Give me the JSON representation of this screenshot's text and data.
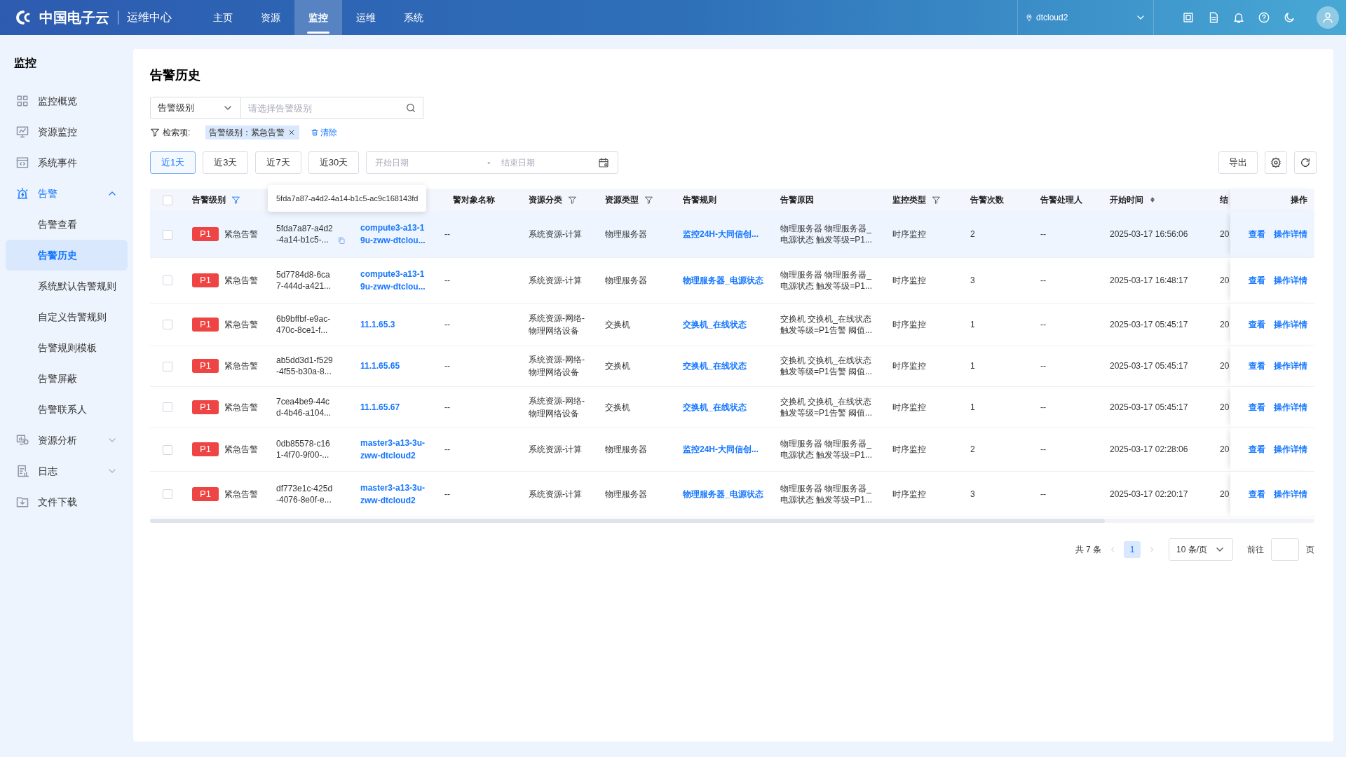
{
  "header": {
    "logo": "中国电子云",
    "product": "运维中心",
    "nav": [
      {
        "label": "主页",
        "selected": false
      },
      {
        "label": "资源",
        "selected": false
      },
      {
        "label": "监控",
        "selected": true
      },
      {
        "label": "运维",
        "selected": false
      },
      {
        "label": "系统",
        "selected": false
      }
    ],
    "cloud": "dtcloud2"
  },
  "sidebar": {
    "title": "监控",
    "items": [
      {
        "label": "监控概览",
        "selected": false
      },
      {
        "label": "资源监控",
        "selected": false
      },
      {
        "label": "系统事件",
        "selected": false
      },
      {
        "label": "告警",
        "selected": false,
        "expanded": true,
        "children": [
          {
            "label": "告警查看",
            "selected": false
          },
          {
            "label": "告警历史",
            "selected": true
          },
          {
            "label": "系统默认告警规则",
            "selected": false
          },
          {
            "label": "自定义告警规则",
            "selected": false
          },
          {
            "label": "告警规则模板",
            "selected": false
          },
          {
            "label": "告警屏蔽",
            "selected": false
          },
          {
            "label": "告警联系人",
            "selected": false
          }
        ]
      },
      {
        "label": "资源分析",
        "selected": false,
        "expanded": false
      },
      {
        "label": "日志",
        "selected": false,
        "expanded": false
      },
      {
        "label": "文件下载",
        "selected": false
      }
    ]
  },
  "page": {
    "title": "告警历史",
    "search": {
      "field": "告警级别",
      "placeholder": "请选择告警级别"
    },
    "filter": {
      "label": "检索项:",
      "tags": [
        "告警级别：紧急告警"
      ],
      "clear": "清除"
    },
    "ranges": [
      {
        "label": "近1天",
        "selected": true
      },
      {
        "label": "近3天",
        "selected": false
      },
      {
        "label": "近7天",
        "selected": false
      },
      {
        "label": "近30天",
        "selected": false
      }
    ],
    "date_range": {
      "start_placeholder": "开始日期",
      "separator": "-",
      "end_placeholder": "结束日期"
    },
    "export": "导出",
    "table": {
      "select_all": {
        "checked": false
      },
      "columns": [
        {
          "label": "告警级别",
          "filter": true
        },
        {
          "label": "警对象名称"
        },
        {
          "label": "资源分类",
          "filter": true
        },
        {
          "label": "资源类型",
          "filter": true
        },
        {
          "label": "告警规则"
        },
        {
          "label": "告警原因"
        },
        {
          "label": "监控类型",
          "filter": true
        },
        {
          "label": "告警次数"
        },
        {
          "label": "告警处理人"
        },
        {
          "label": "开始时间",
          "sortable": true
        },
        {
          "label": "结"
        },
        {
          "label": "操作"
        }
      ],
      "tooltip": "5fda7a87-a4d2-4a14-b1c5-ac9c168143fd",
      "rows": [
        {
          "highlighted": true,
          "checked": false,
          "badge": "P1",
          "level": "紧急告警",
          "id": [
            "5fda7a87-a4d2",
            "-4a14-b1c5-..."
          ],
          "copy": true,
          "object": [
            "compute3-a13-1",
            "9u-zww-dtclou..."
          ],
          "name": "--",
          "category": [
            "系统资源-计算"
          ],
          "type": "物理服务器",
          "rule": "监控24H-大同信创...",
          "reason": [
            "物理服务器 物理服务器_",
            "电源状态 触发等级=P1..."
          ],
          "monitor": "时序监控",
          "count": "2",
          "handler": "--",
          "start": "2025-03-17 16:56:06",
          "end": "20",
          "actions": [
            "查看",
            "操作详情"
          ]
        },
        {
          "highlighted": false,
          "checked": false,
          "badge": "P1",
          "level": "紧急告警",
          "id": [
            "5d7784d8-6ca",
            "7-444d-a421..."
          ],
          "object": [
            "compute3-a13-1",
            "9u-zww-dtclou..."
          ],
          "name": "--",
          "category": [
            "系统资源-计算"
          ],
          "type": "物理服务器",
          "rule": "物理服务器_电源状态",
          "reason": [
            "物理服务器 物理服务器_",
            "电源状态 触发等级=P1..."
          ],
          "monitor": "时序监控",
          "count": "3",
          "handler": "--",
          "start": "2025-03-17 16:48:17",
          "end": "20",
          "actions": [
            "查看",
            "操作详情"
          ]
        },
        {
          "highlighted": false,
          "checked": false,
          "badge": "P1",
          "level": "紧急告警",
          "id": [
            "6b9bffbf-e9ac-",
            "470c-8ce1-f..."
          ],
          "object": [
            "11.1.65.3"
          ],
          "name": "--",
          "category": [
            "系统资源-网络-",
            "物理网络设备"
          ],
          "type": "交换机",
          "rule": "交换机_在线状态",
          "reason": [
            "交换机 交换机_在线状态",
            "触发等级=P1告警 阈值..."
          ],
          "monitor": "时序监控",
          "count": "1",
          "handler": "--",
          "start": "2025-03-17 05:45:17",
          "end": "20",
          "actions": [
            "查看",
            "操作详情"
          ]
        },
        {
          "highlighted": false,
          "checked": false,
          "badge": "P1",
          "level": "紧急告警",
          "id": [
            "ab5dd3d1-f529",
            "-4f55-b30a-8..."
          ],
          "object": [
            "11.1.65.65"
          ],
          "name": "--",
          "category": [
            "系统资源-网络-",
            "物理网络设备"
          ],
          "type": "交换机",
          "rule": "交换机_在线状态",
          "reason": [
            "交换机 交换机_在线状态",
            "触发等级=P1告警 阈值..."
          ],
          "monitor": "时序监控",
          "count": "1",
          "handler": "--",
          "start": "2025-03-17 05:45:17",
          "end": "20",
          "actions": [
            "查看",
            "操作详情"
          ]
        },
        {
          "highlighted": false,
          "checked": false,
          "badge": "P1",
          "level": "紧急告警",
          "id": [
            "7cea4be9-44c",
            "d-4b46-a104..."
          ],
          "object": [
            "11.1.65.67"
          ],
          "name": "--",
          "category": [
            "系统资源-网络-",
            "物理网络设备"
          ],
          "type": "交换机",
          "rule": "交换机_在线状态",
          "reason": [
            "交换机 交换机_在线状态",
            "触发等级=P1告警 阈值..."
          ],
          "monitor": "时序监控",
          "count": "1",
          "handler": "--",
          "start": "2025-03-17 05:45:17",
          "end": "20",
          "actions": [
            "查看",
            "操作详情"
          ]
        },
        {
          "highlighted": false,
          "checked": false,
          "badge": "P1",
          "level": "紧急告警",
          "id": [
            "0db85578-c16",
            "1-4f70-9f00-..."
          ],
          "object": [
            "master3-a13-3u-",
            "zww-dtcloud2"
          ],
          "name": "--",
          "category": [
            "系统资源-计算"
          ],
          "type": "物理服务器",
          "rule": "监控24H-大同信创...",
          "reason": [
            "物理服务器 物理服务器_",
            "电源状态 触发等级=P1..."
          ],
          "monitor": "时序监控",
          "count": "2",
          "handler": "--",
          "start": "2025-03-17 02:28:06",
          "end": "20",
          "actions": [
            "查看",
            "操作详情"
          ]
        },
        {
          "highlighted": false,
          "checked": false,
          "badge": "P1",
          "level": "紧急告警",
          "id": [
            "df773e1c-425d",
            "-4076-8e0f-e..."
          ],
          "object": [
            "master3-a13-3u-",
            "zww-dtcloud2"
          ],
          "name": "--",
          "category": [
            "系统资源-计算"
          ],
          "type": "物理服务器",
          "rule": "物理服务器_电源状态",
          "reason": [
            "物理服务器 物理服务器_",
            "电源状态 触发等级=P1..."
          ],
          "monitor": "时序监控",
          "count": "3",
          "handler": "--",
          "start": "2025-03-17 02:20:17",
          "end": "20",
          "actions": [
            "查看",
            "操作详情"
          ]
        }
      ]
    },
    "pagination": {
      "total": "共 7 条",
      "pages": [
        {
          "label": "1",
          "selected": true
        }
      ],
      "page_size": "10 条/页",
      "goto": "前往",
      "goto_suffix": "页"
    }
  }
}
